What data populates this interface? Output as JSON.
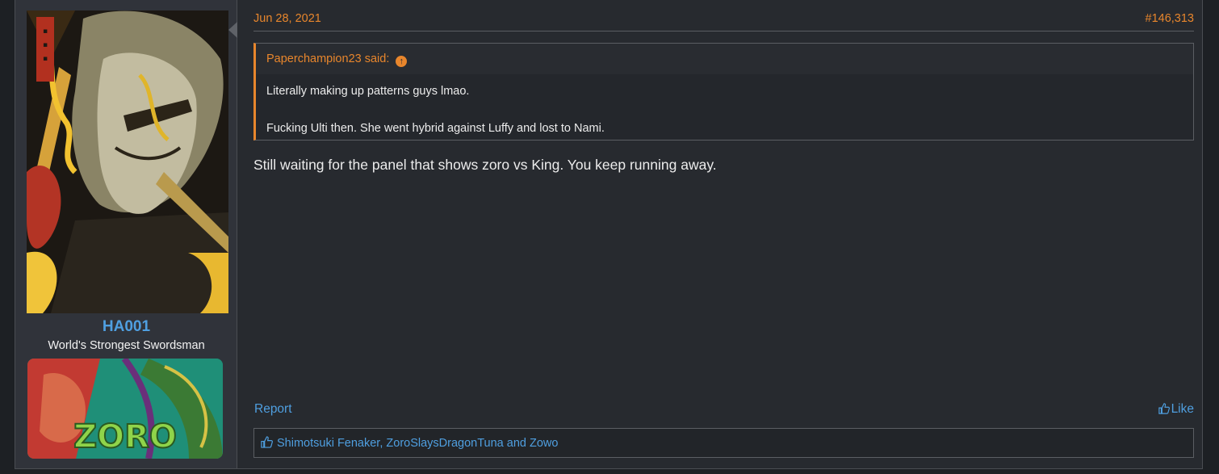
{
  "user": {
    "name": "HA001",
    "title": "World's Strongest Swordsman",
    "banner_text": "ZORO"
  },
  "post": {
    "date": "Jun 28, 2021",
    "number": "#146,313",
    "quote": {
      "author": "Paperchampion23 said:",
      "line1": "Literally making up patterns guys lmao.",
      "line2": "Fucking Ulti then. She went hybrid against Luffy and lost to Nami."
    },
    "message": "Still waiting for the panel that shows zoro vs King. You keep running away.",
    "report_label": "Report",
    "like_label": "Like",
    "likes_text": "Shimotsuki Fenaker, ZoroSlaysDragonTuna and Zowo"
  },
  "colors": {
    "accent": "#e8862c",
    "link": "#4f9fe0",
    "background": "#272a2f"
  }
}
